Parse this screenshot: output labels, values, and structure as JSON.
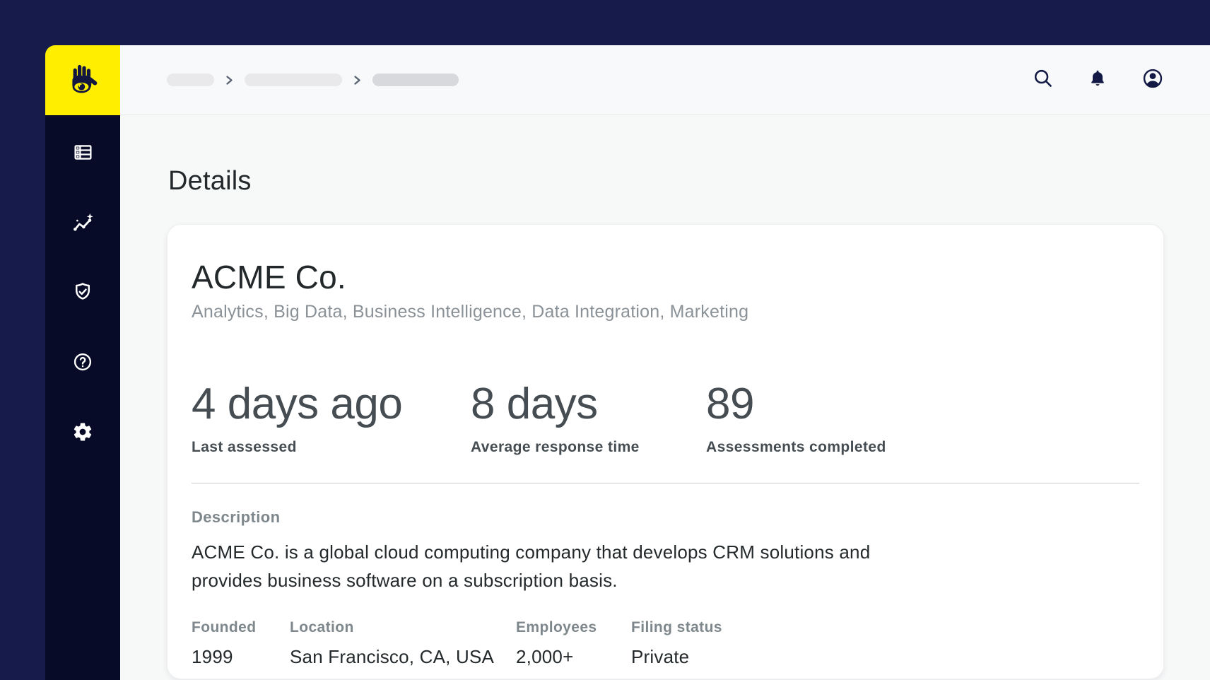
{
  "app": {
    "logo_icon": "hand-eye-logo",
    "brand_colors": {
      "yellow": "#FFEE00",
      "navy": "#161B4B",
      "sidebar_navy": "#070B28",
      "icon_navy": "#131A45"
    }
  },
  "header": {
    "breadcrumb": {
      "items": [
        {
          "label": "",
          "placeholder": true
        },
        {
          "label": "",
          "placeholder": true
        },
        {
          "label": "",
          "placeholder": true
        }
      ],
      "separator_icon": "chevron-right-icon"
    },
    "actions": [
      {
        "icon": "search-icon"
      },
      {
        "icon": "bell-icon"
      },
      {
        "icon": "avatar-icon"
      }
    ]
  },
  "sidebar": {
    "items": [
      {
        "icon": "table-icon"
      },
      {
        "icon": "trend-sparkle-icon"
      },
      {
        "icon": "shield-check-icon"
      },
      {
        "icon": "help-icon"
      },
      {
        "icon": "gear-icon"
      }
    ]
  },
  "page": {
    "title": "Details"
  },
  "company": {
    "name": "ACME Co.",
    "tags": "Analytics, Big Data, Business Intelligence, Data Integration, Marketing"
  },
  "stats": [
    {
      "value": "4 days ago",
      "label": "Last assessed"
    },
    {
      "value": "8 days",
      "label": "Average response time"
    },
    {
      "value": "89",
      "label": "Assessments completed"
    }
  ],
  "description": {
    "label": "Description",
    "text": "ACME Co. is a global cloud computing company that develops CRM solutions and\nprovides business software on a subscription basis."
  },
  "facts": [
    {
      "label": "Founded",
      "value": "1999"
    },
    {
      "label": "Location",
      "value": "San Francisco, CA, USA"
    },
    {
      "label": "Employees",
      "value": "2,000+"
    },
    {
      "label": "Filing status",
      "value": "Private"
    }
  ]
}
